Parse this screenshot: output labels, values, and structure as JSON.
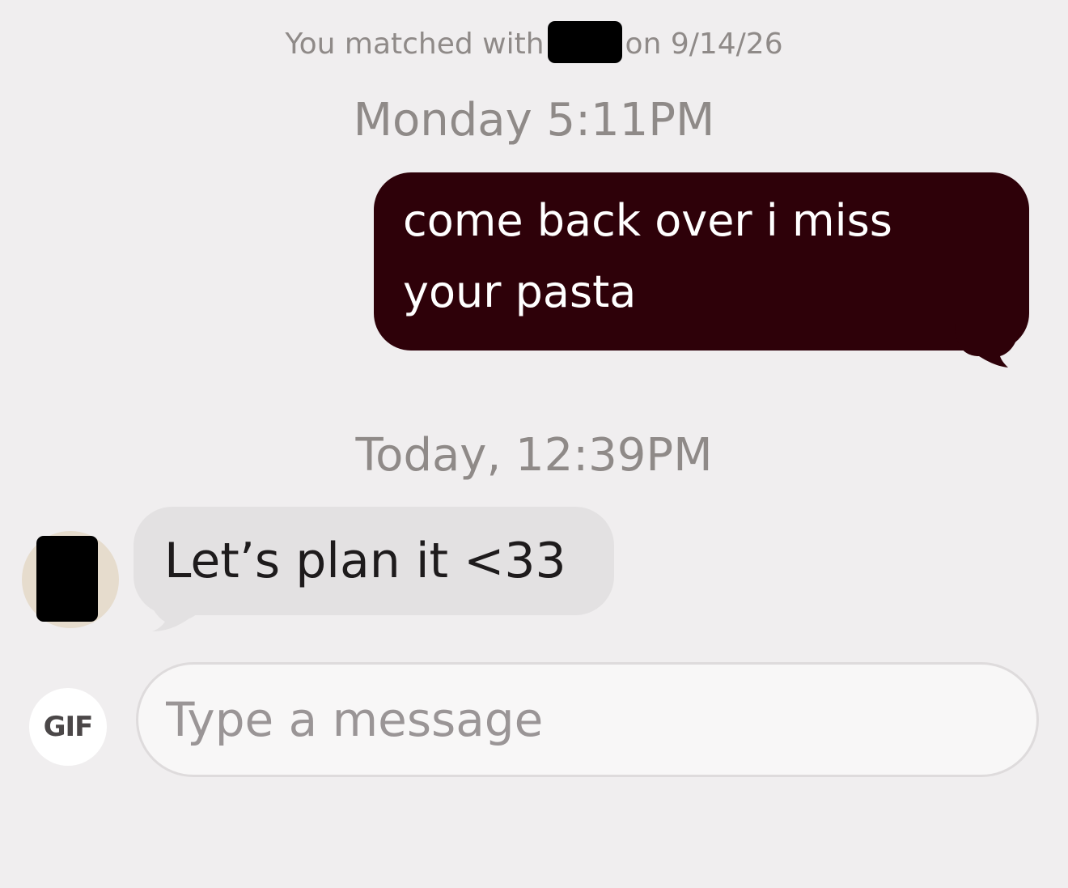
{
  "match": {
    "prefix": "You matched with",
    "suffix": "on 9/14/26"
  },
  "conversation": {
    "timestamps": [
      "Monday 5:11PM",
      "Today, 12:39PM"
    ],
    "outgoing_message": "come back over i miss your pasta",
    "incoming_message": "Let’s plan it <33"
  },
  "composer": {
    "gif_label": "GIF",
    "placeholder": "Type a message"
  },
  "colors": {
    "background": "#f0eeef",
    "outgoing_bubble": "#2e0109",
    "incoming_bubble": "#e3e1e2",
    "muted_text": "#8f8a88"
  },
  "icons": {
    "gif": "gif-icon"
  }
}
